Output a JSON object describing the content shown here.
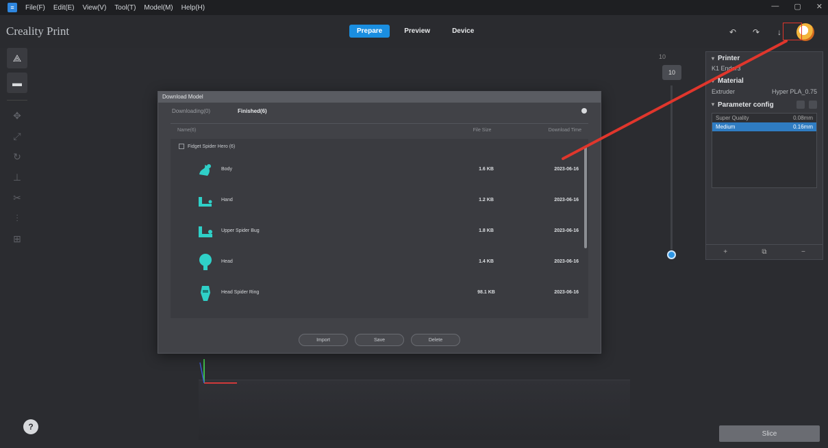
{
  "menubar": {
    "items": [
      "File(F)",
      "Edit(E)",
      "View(V)",
      "Tool(T)",
      "Model(M)",
      "Help(H)"
    ],
    "controls": [
      "—",
      "▢",
      "✕"
    ]
  },
  "titlebar": {
    "brand": "Creality Print",
    "tabs": [
      "Prepare",
      "Preview",
      "Device"
    ],
    "icon_undo": "↶",
    "icon_redo": "↷",
    "icon_download": "↓"
  },
  "dialog": {
    "title": "Download Model",
    "tabs": [
      "Downloading(0)",
      "Finished(6)"
    ],
    "columns": [
      "Name(6)",
      "File Size",
      "Download Time"
    ],
    "group": "Fidget Spider Hero (6)",
    "files": [
      {
        "name": "Body",
        "size": "1.6 KB",
        "date": "2023-06-16"
      },
      {
        "name": "Hand",
        "size": "1.2 KB",
        "date": "2023-06-16"
      },
      {
        "name": "Upper Spider Bug",
        "size": "1.8 KB",
        "date": "2023-06-16"
      },
      {
        "name": "Head",
        "size": "1.4 KB",
        "date": "2023-06-16"
      },
      {
        "name": "Head Spider Ring",
        "size": "98.1 KB",
        "date": "2023-06-16"
      }
    ],
    "buttons": [
      "Import",
      "Save",
      "Delete"
    ]
  },
  "right_panel": {
    "printer_head": "Printer",
    "printer_name": "K1 Ender3",
    "material_head": "Material",
    "material_label": "Extruder",
    "material_value": "Hyper PLA_0.75",
    "param_head": "Parameter config",
    "list": [
      {
        "name": "Super Quality",
        "value": "0.08mm"
      },
      {
        "name": "Medium",
        "value": "0.16mm"
      }
    ],
    "bottom_icons": [
      "+",
      "⧉",
      "−"
    ]
  },
  "viewport": {
    "slider_label": "10",
    "slider_value": "10"
  },
  "slice_button": "Slice",
  "help_icon": "?",
  "colors": {
    "accent": "#1a8ee0",
    "annotation": "#e0362c",
    "model": "#2fd0c8"
  }
}
